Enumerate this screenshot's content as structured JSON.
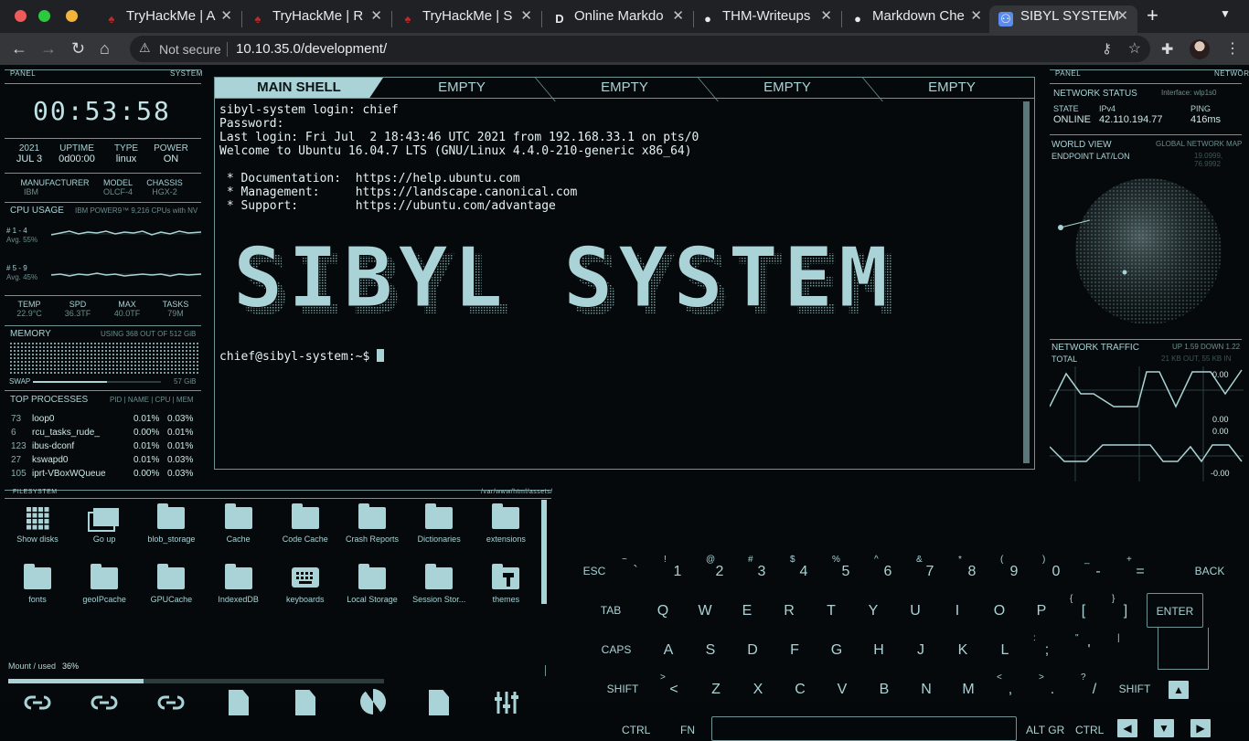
{
  "browser": {
    "tabs": [
      {
        "title": "TryHackMe | A",
        "icon": "tryhackme-icon"
      },
      {
        "title": "TryHackMe | R",
        "icon": "tryhackme-icon"
      },
      {
        "title": "TryHackMe | S",
        "icon": "tryhackme-icon"
      },
      {
        "title": "Online Markdo",
        "icon": "dillinger-icon",
        "glyph": "D"
      },
      {
        "title": "THM-Writeups",
        "icon": "github-icon"
      },
      {
        "title": "Markdown Che",
        "icon": "github-icon"
      },
      {
        "title": "SIBYL SYSTEM",
        "icon": "sibyl-icon",
        "active": true
      }
    ],
    "omnibox": {
      "security": "Not secure",
      "url": "10.10.35.0/development/"
    }
  },
  "panel_left": {
    "header_left": "PANEL",
    "header_right": "SYSTEM",
    "clock": "00:53:58",
    "year": "2021",
    "date": "JUL 3",
    "uptime_label": "UPTIME",
    "uptime_value": "0d00:00",
    "type_label": "TYPE",
    "type_value": "linux",
    "power_label": "POWER",
    "power_value": "ON",
    "manufacturer_label": "MANUFACTURER",
    "manufacturer_value": "IBM",
    "model_label": "MODEL",
    "model_value": "OLCF-4",
    "chassis_label": "CHASSIS",
    "chassis_value": "HGX-2",
    "cpu_label": "CPU USAGE",
    "cpu_desc": "IBM POWER9™ 9,216 CPUs with NV",
    "cpu1_label": "# 1 - 4",
    "cpu1_avg": "Avg. 55%",
    "cpu2_label": "# 5 - 9",
    "cpu2_avg": "Avg. 45%",
    "temp_label": "TEMP",
    "temp_value": "22.9°C",
    "spd_label": "SPD",
    "spd_value": "36.3TF",
    "max_label": "MAX",
    "max_value": "40.0TF",
    "tasks_label": "TASKS",
    "tasks_value": "79M",
    "memory_label": "MEMORY",
    "memory_desc": "USING 368 OUT OF 512 GiB",
    "swap_label": "SWAP",
    "swap_value": "57 GiB",
    "proc_label": "TOP PROCESSES",
    "proc_cols": "PID | NAME | CPU | MEM",
    "processes": [
      {
        "pid": "73",
        "name": "loop0",
        "cpu": "0.01%",
        "mem": "0.03%"
      },
      {
        "pid": "6",
        "name": "rcu_tasks_rude_",
        "cpu": "0.00%",
        "mem": "0.01%"
      },
      {
        "pid": "123",
        "name": "ibus-dconf",
        "cpu": "0.01%",
        "mem": "0.01%"
      },
      {
        "pid": "27",
        "name": "kswapd0",
        "cpu": "0.01%",
        "mem": "0.03%"
      },
      {
        "pid": "105",
        "name": "iprt-VBoxWQueue",
        "cpu": "0.00%",
        "mem": "0.03%"
      }
    ]
  },
  "shell": {
    "tabs": [
      "MAIN SHELL",
      "EMPTY",
      "EMPTY",
      "EMPTY",
      "EMPTY"
    ],
    "lines": [
      "sibyl-system login: chief",
      "Password:",
      "Last login: Fri Jul  2 18:43:46 UTC 2021 from 192.168.33.1 on pts/0",
      "Welcome to Ubuntu 16.04.7 LTS (GNU/Linux 4.4.0-210-generic x86_64)",
      "",
      " * Documentation:  https://help.ubuntu.com",
      " * Management:     https://landscape.canonical.com",
      " * Support:        https://ubuntu.com/advantage"
    ],
    "banner": "SIBYL SYSTEM",
    "prompt": "chief@sibyl-system:~$ "
  },
  "panel_right": {
    "header_left": "PANEL",
    "header_right": "NETWORK",
    "net_status_label": "NETWORK STATUS",
    "interface": "Interface: wlp1s0",
    "state_label": "STATE",
    "state_value": "ONLINE",
    "ipv4_label": "IPv4",
    "ipv4_value": "42.110.194.77",
    "ping_label": "PING",
    "ping_value": "416ms",
    "world_label": "WORLD VIEW",
    "world_desc": "GLOBAL NETWORK MAP",
    "endpoint_label": "ENDPOINT LAT/LON",
    "endpoint_value": "19.0999, 76.9992",
    "traffic_label": "NETWORK TRAFFIC",
    "traffic_desc": "UP 1.59 DOWN 1.22",
    "total_label": "TOTAL",
    "total_value": "21 KB OUT, 55 KB IN",
    "graph_top_max": "0.00",
    "graph_top_min": "0.00",
    "graph_bot_max": "0.00",
    "graph_bot_min": "-0.00"
  },
  "filesystem": {
    "label": "FILESYSTEM",
    "path": "/var/www/html/assets/",
    "items": [
      {
        "name": "Show disks",
        "type": "grid"
      },
      {
        "name": "Go up",
        "type": "goup"
      },
      {
        "name": "blob_storage",
        "type": "folder"
      },
      {
        "name": "Cache",
        "type": "folder"
      },
      {
        "name": "Code Cache",
        "type": "folder"
      },
      {
        "name": "Crash Reports",
        "type": "folder"
      },
      {
        "name": "Dictionaries",
        "type": "folder"
      },
      {
        "name": "extensions",
        "type": "folder"
      },
      {
        "name": "fonts",
        "type": "folder"
      },
      {
        "name": "geoIPcache",
        "type": "folder"
      },
      {
        "name": "GPUCache",
        "type": "folder"
      },
      {
        "name": "IndexedDB",
        "type": "folder"
      },
      {
        "name": "keyboards",
        "type": "keyboard"
      },
      {
        "name": "Local Storage",
        "type": "folder"
      },
      {
        "name": "Session Stor...",
        "type": "folder"
      },
      {
        "name": "themes",
        "type": "themes"
      }
    ],
    "mount_label": "Mount / used",
    "mount_value": "36%",
    "mount_fraction": 0.36
  },
  "keyboard": {
    "row1": [
      {
        "k": "ESC"
      },
      {
        "k": "`",
        "s": "~"
      },
      {
        "k": "1",
        "s": "!"
      },
      {
        "k": "2",
        "s": "@"
      },
      {
        "k": "3",
        "s": "#"
      },
      {
        "k": "4",
        "s": "$"
      },
      {
        "k": "5",
        "s": "%"
      },
      {
        "k": "6",
        "s": "^"
      },
      {
        "k": "7",
        "s": "&"
      },
      {
        "k": "8",
        "s": "*"
      },
      {
        "k": "9",
        "s": "("
      },
      {
        "k": "0",
        "s": ")"
      },
      {
        "k": "-",
        "s": "_"
      },
      {
        "k": "=",
        "s": "+"
      },
      {
        "k": "BACK"
      }
    ],
    "row2": [
      {
        "k": "TAB"
      },
      {
        "k": "Q"
      },
      {
        "k": "W"
      },
      {
        "k": "E"
      },
      {
        "k": "R"
      },
      {
        "k": "T"
      },
      {
        "k": "Y"
      },
      {
        "k": "U"
      },
      {
        "k": "I"
      },
      {
        "k": "O"
      },
      {
        "k": "P"
      },
      {
        "k": "[",
        "s": "{"
      },
      {
        "k": "]",
        "s": "}"
      }
    ],
    "enter": "ENTER",
    "row3": [
      {
        "k": "CAPS"
      },
      {
        "k": "A"
      },
      {
        "k": "S"
      },
      {
        "k": "D"
      },
      {
        "k": "F"
      },
      {
        "k": "G"
      },
      {
        "k": "H"
      },
      {
        "k": "J"
      },
      {
        "k": "K"
      },
      {
        "k": "L"
      },
      {
        "k": ";",
        "s": ":"
      },
      {
        "k": "'",
        "s": "\""
      },
      {
        "k": "",
        "s": "|"
      }
    ],
    "row4": [
      {
        "k": "SHIFT"
      },
      {
        "k": "<",
        "s": ">"
      },
      {
        "k": "Z"
      },
      {
        "k": "X"
      },
      {
        "k": "C"
      },
      {
        "k": "V"
      },
      {
        "k": "B"
      },
      {
        "k": "N"
      },
      {
        "k": "M"
      },
      {
        "k": ",",
        "s": "<"
      },
      {
        "k": ".",
        "s": ">"
      },
      {
        "k": "/",
        "s": "?"
      },
      {
        "k": "SHIFT"
      }
    ],
    "row5": {
      "ctrl": "CTRL",
      "fn": "FN",
      "altgr": "ALT GR",
      "ctrl2": "CTRL"
    },
    "arrows": {
      "up": "▲",
      "left": "◀",
      "down": "▼",
      "right": "▶"
    }
  },
  "colors": {
    "accent": "#a9d3d6",
    "background": "#05090b",
    "text": "#e6f2f3"
  }
}
